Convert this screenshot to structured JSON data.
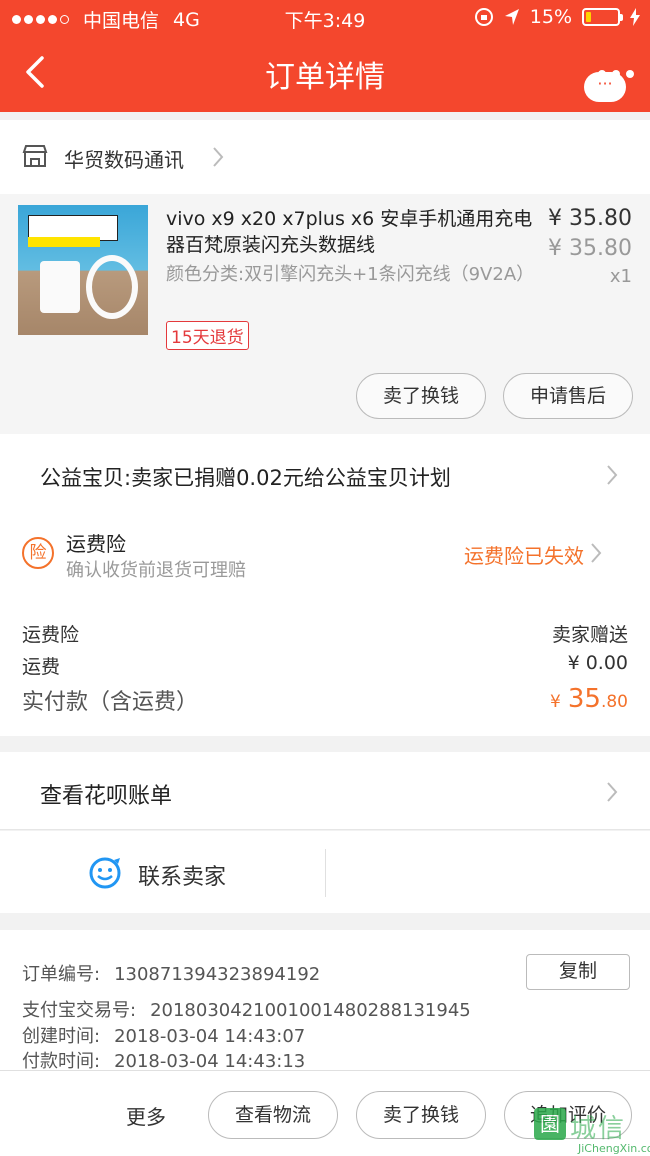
{
  "status_bar": {
    "carrier": "中国电信",
    "network": "4G",
    "time": "下午3:49",
    "battery": "15%",
    "battery_level": 0.15
  },
  "header": {
    "title": "订单详情",
    "more_bubble": "···"
  },
  "shop": {
    "name": "华贸数码通讯"
  },
  "product": {
    "title": "vivo x9 x20 x7plus x6 安卓手机通用充电器百梵原装闪充头数据线",
    "sku": "颜色分类:双引擎闪充头+1条闪充线（9V2A）",
    "price": "¥ 35.80",
    "original_price": "¥ 35.80",
    "quantity": "x1",
    "return_tag": "15天退货",
    "sell_label": "卖了换钱",
    "aftersale_label": "申请售后"
  },
  "donation": {
    "text": "公益宝贝:卖家已捐赠0.02元给公益宝贝计划"
  },
  "insurance": {
    "icon_text": "险",
    "title": "运费险",
    "subtitle": "确认收货前退货可理赔",
    "status": "运费险已失效",
    "status_color": "#f4722b"
  },
  "fees": {
    "insurance_label": "运费险",
    "insurance_value": "卖家赠送",
    "shipping_label": "运费",
    "shipping_value": "¥ 0.00",
    "paid_label": "实付款（含运费）",
    "paid_currency": "¥",
    "paid_int": "35",
    "paid_dec": ".80"
  },
  "huabei": {
    "text": "查看花呗账单"
  },
  "contact": {
    "text": "联系卖家"
  },
  "order_info": {
    "order_no_label": "订单编号:",
    "order_no": "1308713943238941​92",
    "copy_label": "复制",
    "alipay_label": "支付宝交易号:",
    "alipay_no": "2018030421001001480288131945",
    "created_label": "创建时间:",
    "created": "2018-03-04 14:43:07",
    "paid_label": "付款时间:",
    "paid": "2018-03-04 14:43:13"
  },
  "bottom_bar": {
    "more": "更多",
    "logistics": "查看物流",
    "sell": "卖了换钱",
    "review": "追加评价"
  },
  "watermark": {
    "logo": "園",
    "cn": "城信",
    "en": "JiChengXin.com"
  },
  "colors": {
    "brand": "#f4472d",
    "accent": "#f4722b",
    "tag": "#e4393c"
  }
}
